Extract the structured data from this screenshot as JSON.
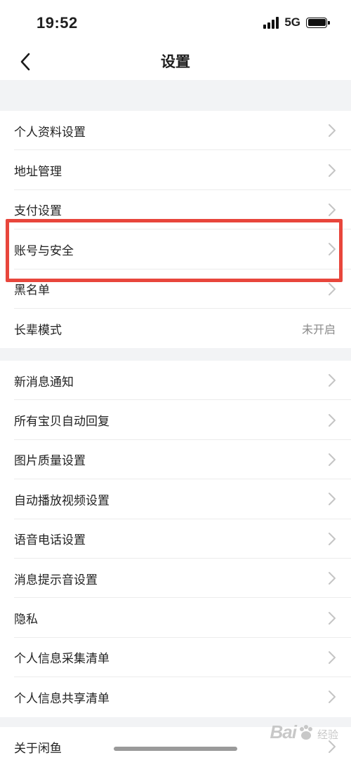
{
  "status_bar": {
    "time": "19:52",
    "network": "5G"
  },
  "nav": {
    "title": "设置"
  },
  "groups": [
    {
      "rows": [
        {
          "label": "个人资料设置",
          "value": ""
        },
        {
          "label": "地址管理",
          "value": ""
        },
        {
          "label": "支付设置",
          "value": ""
        },
        {
          "label": "账号与安全",
          "value": ""
        },
        {
          "label": "黑名单",
          "value": ""
        },
        {
          "label": "长辈模式",
          "value": "未开启"
        }
      ]
    },
    {
      "rows": [
        {
          "label": "新消息通知",
          "value": ""
        },
        {
          "label": "所有宝贝自动回复",
          "value": ""
        },
        {
          "label": "图片质量设置",
          "value": ""
        },
        {
          "label": "自动播放视频设置",
          "value": ""
        },
        {
          "label": "语音电话设置",
          "value": ""
        },
        {
          "label": "消息提示音设置",
          "value": ""
        },
        {
          "label": "隐私",
          "value": ""
        },
        {
          "label": "个人信息采集清单",
          "value": ""
        },
        {
          "label": "个人信息共享清单",
          "value": ""
        }
      ]
    },
    {
      "rows": [
        {
          "label": "关于闲鱼",
          "value": ""
        }
      ]
    }
  ],
  "highlight": {
    "color": "#e8463c",
    "target": "账号与安全"
  },
  "watermark": {
    "text": "Bai",
    "sub": "经验"
  }
}
